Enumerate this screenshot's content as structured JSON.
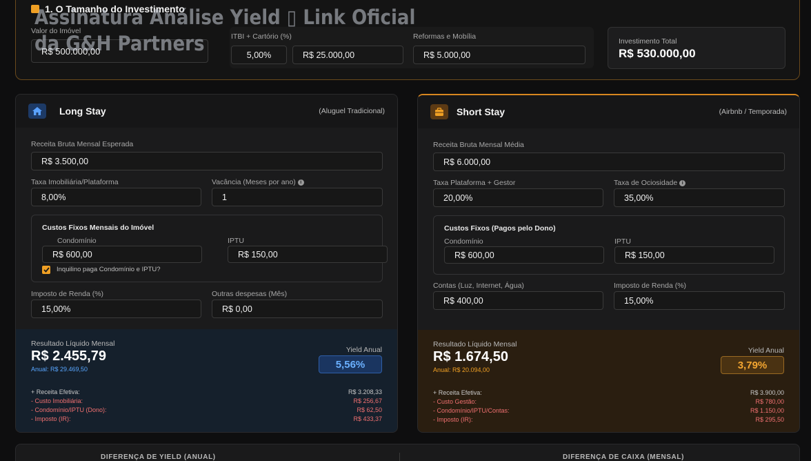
{
  "watermark": {
    "line1": "Assinatura Análise Yield ▯ Link Oficial",
    "line2": "da G&H Partners"
  },
  "investment": {
    "section_title": "1. O Tamanho do Investimento",
    "property_label": "Valor do Imóvel",
    "property_value": "R$ 500.000,00",
    "itbi_label": "ITBI + Cartório (%)",
    "itbi_percent": "5,00%",
    "itbi_amount": "R$ 25.000,00",
    "renovation_label": "Reformas e Mobília",
    "renovation_value": "R$ 5.000,00",
    "total_label": "Investimento Total",
    "total_value": "R$ 530.000,00"
  },
  "long_stay": {
    "title": "Long Stay",
    "subtitle": "(Aluguel Tradicional)",
    "revenue_label": "Receita Bruta Mensal Esperada",
    "revenue_value": "R$ 3.500,00",
    "fee_label": "Taxa Imobiliária/Plataforma",
    "fee_value": "8,00%",
    "vacancy_label": "Vacância (Meses por ano)",
    "vacancy_value": "1",
    "costs_title": "Custos Fixos Mensais do Imóvel",
    "condo_label": "Condomínio",
    "condo_value": "R$ 600,00",
    "iptu_label": "IPTU",
    "iptu_value": "R$ 150,00",
    "tenant_pays_label": "Inquilino paga Condomínio e IPTU?",
    "tax_label": "Imposto de Renda (%)",
    "tax_value": "15,00%",
    "other_label": "Outras despesas (Mês)",
    "other_value": "R$ 0,00",
    "result_label": "Resultado Líquido Mensal",
    "result_value": "R$ 2.455,79",
    "annual": "Anual: R$ 29.469,50",
    "yield_label": "Yield Anual",
    "yield_value": "5,56%",
    "breakdown": [
      {
        "label": "+ Receita Efetiva:",
        "value": "R$ 3.208,33"
      },
      {
        "label": "- Custo Imobiliária:",
        "value": "R$ 256,67"
      },
      {
        "label": "- Condomínio/IPTU (Dono):",
        "value": "R$ 62,50"
      },
      {
        "label": "- Imposto (IR):",
        "value": "R$ 433,37"
      }
    ]
  },
  "short_stay": {
    "title": "Short Stay",
    "subtitle": "(Airbnb / Temporada)",
    "revenue_label": "Receita Bruta Mensal Média",
    "revenue_value": "R$ 6.000,00",
    "fee_label": "Taxa Plataforma + Gestor",
    "fee_value": "20,00%",
    "idle_label": "Taxa de Ociosidade",
    "idle_value": "35,00%",
    "costs_title": "Custos Fixos (Pagos pelo Dono)",
    "condo_label": "Condomínio",
    "condo_value": "R$ 600,00",
    "iptu_label": "IPTU",
    "iptu_value": "R$ 150,00",
    "bills_label": "Contas (Luz, Internet, Água)",
    "bills_value": "R$ 400,00",
    "tax_label": "Imposto de Renda (%)",
    "tax_value": "15,00%",
    "result_label": "Resultado Líquido Mensal",
    "result_value": "R$ 1.674,50",
    "annual": "Anual: R$ 20.094,00",
    "yield_label": "Yield Anual",
    "yield_value": "3,79%",
    "breakdown": [
      {
        "label": "+ Receita Efetiva:",
        "value": "R$ 3.900,00"
      },
      {
        "label": "- Custo Gestão:",
        "value": "R$ 780,00"
      },
      {
        "label": "- Condomínio/IPTU/Contas:",
        "value": "R$ 1.150,00"
      },
      {
        "label": "- Imposto (IR):",
        "value": "R$ 295,50"
      }
    ]
  },
  "bottom": {
    "yield_diff_label": "DIFERENÇA DE YIELD (ANUAL)",
    "cash_diff_label": "DIFERENÇA DE CAIXA (MENSAL)"
  },
  "colors": {
    "accent_orange": "#f0a024",
    "accent_blue": "#58a6ff",
    "negative_red": "#f07070"
  },
  "icons": {
    "section": "square-icon",
    "long_stay": "home-icon",
    "short_stay": "briefcase-icon",
    "info": "info-icon",
    "checkbox": "check-icon"
  }
}
